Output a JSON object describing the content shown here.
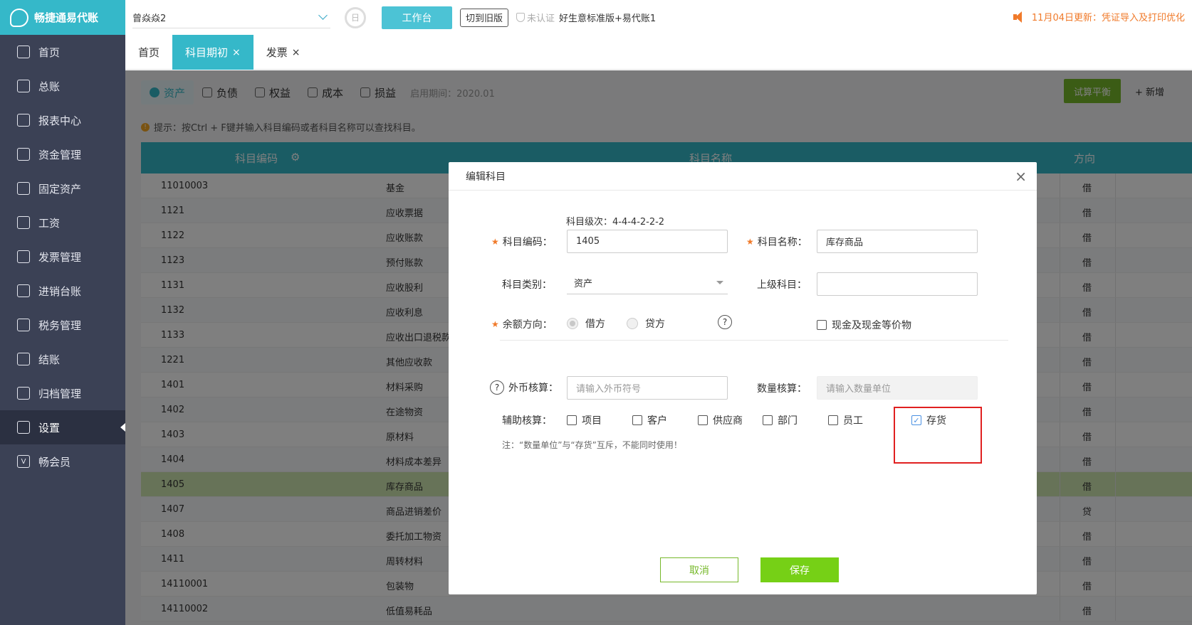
{
  "app": {
    "logo_text": "畅捷通易代账",
    "company": "曾焱焱2",
    "workbench_label": "工作台",
    "old_version_label": "切到旧版",
    "cert_status": "未认证",
    "version_label": "好生意标准版+易代账1",
    "notice": "11月04日更新：凭证导入及打印优化"
  },
  "sidebar": {
    "items": [
      {
        "label": "首页",
        "icon": "home-icon"
      },
      {
        "label": "总账",
        "icon": "ledger-icon"
      },
      {
        "label": "报表中心",
        "icon": "chart-icon"
      },
      {
        "label": "资金管理",
        "icon": "money-bag-icon"
      },
      {
        "label": "固定资产",
        "icon": "building-icon"
      },
      {
        "label": "工资",
        "icon": "salary-icon"
      },
      {
        "label": "发票管理",
        "icon": "invoice-icon"
      },
      {
        "label": "进销台账",
        "icon": "inventory-icon"
      },
      {
        "label": "税务管理",
        "icon": "tax-icon"
      },
      {
        "label": "结账",
        "icon": "checkout-icon"
      },
      {
        "label": "归档管理",
        "icon": "archive-icon"
      },
      {
        "label": "设置",
        "icon": "gear-icon"
      },
      {
        "label": "畅会员",
        "icon": "vip-icon"
      }
    ]
  },
  "tabs": [
    {
      "label": "首页"
    },
    {
      "label": "科目期初",
      "close": "×"
    },
    {
      "label": "发票",
      "close": "×"
    }
  ],
  "account_tabs": [
    {
      "label": "资产"
    },
    {
      "label": "负债"
    },
    {
      "label": "权益"
    },
    {
      "label": "成本"
    },
    {
      "label": "损益"
    }
  ],
  "period_label": "启用期间：2020.01",
  "actions": {
    "trial_balance": "试算平衡",
    "add": "+ 新增"
  },
  "tip": "提示：按Ctrl + F键并输入科目编码或者科目名称可以查找科目。",
  "grid": {
    "headers": {
      "code": "科目编码",
      "name": "科目名称",
      "direction": "方向"
    },
    "rows": [
      {
        "code": "11010003",
        "name": "基金",
        "dir": "借"
      },
      {
        "code": "1121",
        "name": "应收票据",
        "dir": "借"
      },
      {
        "code": "1122",
        "name": "应收账款",
        "dir": "借"
      },
      {
        "code": "1123",
        "name": "预付账款",
        "dir": "借"
      },
      {
        "code": "1131",
        "name": "应收股利",
        "dir": "借"
      },
      {
        "code": "1132",
        "name": "应收利息",
        "dir": "借"
      },
      {
        "code": "1133",
        "name": "应收出口退税款",
        "dir": "借"
      },
      {
        "code": "1221",
        "name": "其他应收款",
        "dir": "借"
      },
      {
        "code": "1401",
        "name": "材料采购",
        "dir": "借"
      },
      {
        "code": "1402",
        "name": "在途物资",
        "dir": "借"
      },
      {
        "code": "1403",
        "name": "原材料",
        "dir": "借"
      },
      {
        "code": "1404",
        "name": "材料成本差异",
        "dir": "借"
      },
      {
        "code": "1405",
        "name": "库存商品",
        "dir": "借"
      },
      {
        "code": "1407",
        "name": "商品进销差价",
        "dir": "贷"
      },
      {
        "code": "1408",
        "name": "委托加工物资",
        "dir": "借"
      },
      {
        "code": "1411",
        "name": "周转材料",
        "dir": "借"
      },
      {
        "code": "14110001",
        "name": "包装物",
        "dir": "借"
      },
      {
        "code": "14110002",
        "name": "低值易耗品",
        "dir": "借"
      }
    ]
  },
  "modal": {
    "title": "编辑科目",
    "close": "×",
    "level_hint": "科目级次：4-4-4-2-2-2",
    "code_label": "科目编码：",
    "code_value": "1405",
    "name_label": "科目名称：",
    "name_value": "库存商品",
    "category_label": "科目类别：",
    "category_value": "资产",
    "parent_label": "上级科目：",
    "parent_value": "",
    "balance_label": "余额方向：",
    "debit": "借方",
    "credit": "贷方",
    "cash_equiv": "现金及现金等价物",
    "foreign_label": "外币核算：",
    "foreign_placeholder": "请输入外币符号",
    "qty_label": "数量核算：",
    "qty_placeholder": "请输入数量单位",
    "aux_label": "辅助核算：",
    "aux_options": [
      "项目",
      "客户",
      "供应商",
      "部门",
      "员工",
      "存货"
    ],
    "note": "注：“数量单位”与“存货”互斥，不能同时使用！",
    "cancel": "取消",
    "save": "保存"
  }
}
